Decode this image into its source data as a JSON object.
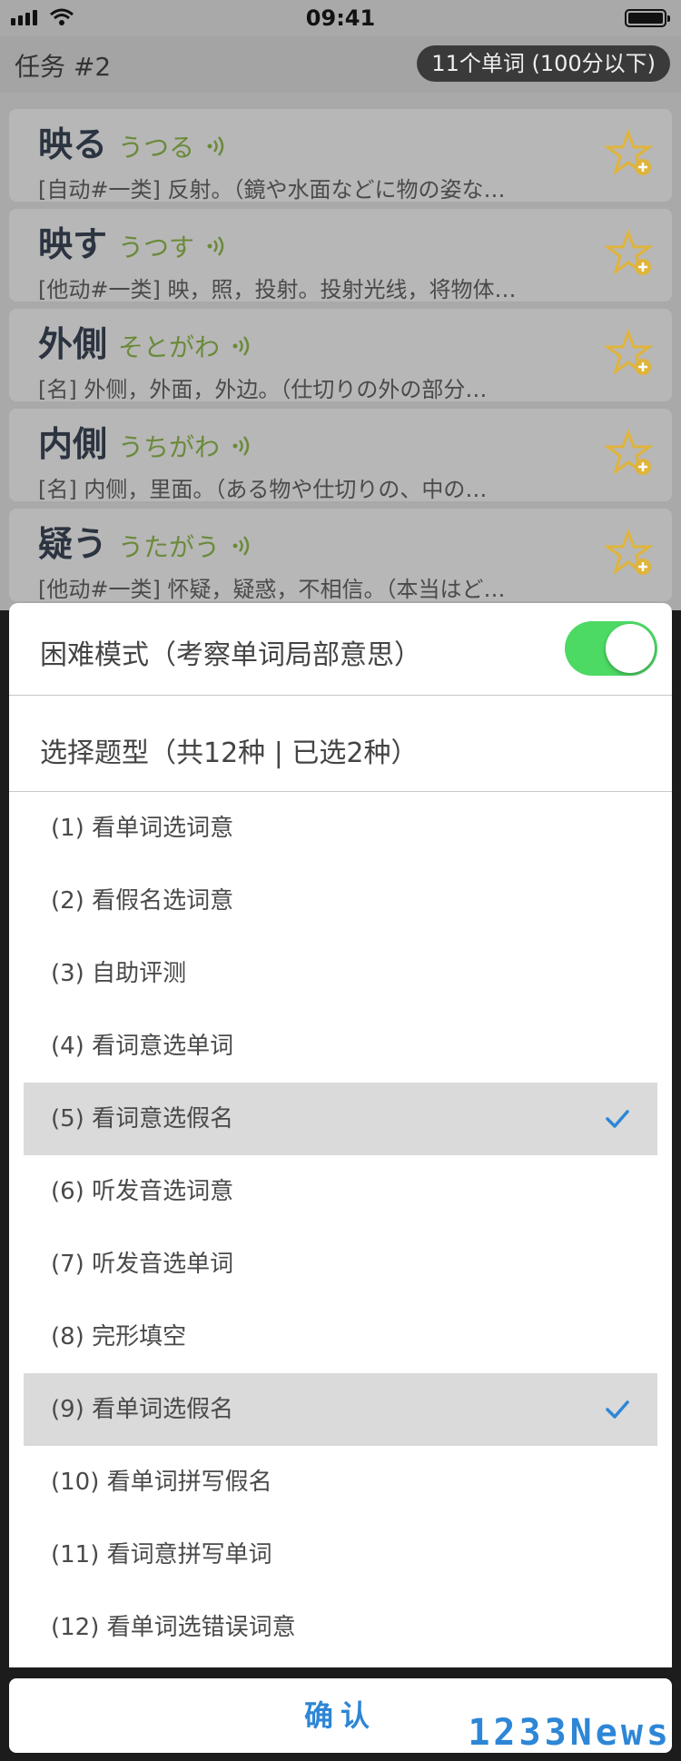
{
  "status_bar": {
    "time": "09:41"
  },
  "nav": {
    "title": "任务 #2",
    "badge": "11个单词 (100分以下)"
  },
  "words": [
    {
      "kanji": "映る",
      "kana": "うつる",
      "definition": "[自动#一类] 反射。（鏡や水面などに物の姿な…"
    },
    {
      "kanji": "映す",
      "kana": "うつす",
      "definition": "[他动#一类] 映，照，投射。投射光线，将物体…"
    },
    {
      "kanji": "外側",
      "kana": "そとがわ",
      "definition": "[名] 外侧，外面，外边。（仕切りの外の部分…"
    },
    {
      "kanji": "内側",
      "kana": "うちがわ",
      "definition": "[名] 内侧，里面。（ある物や仕切りの、中の…"
    },
    {
      "kanji": "疑う",
      "kana": "うたがう",
      "definition": "[他动#一类] 怀疑，疑惑，不相信。（本当はど…"
    }
  ],
  "sheet": {
    "hard_mode_label": "困难模式（考察单词局部意思）",
    "hard_mode_on": true,
    "types_header": "选择题型（共12种 | 已选2种）",
    "types": [
      {
        "label": "(1) 看单词选词意",
        "selected": false
      },
      {
        "label": "(2) 看假名选词意",
        "selected": false
      },
      {
        "label": "(3) 自助评测",
        "selected": false
      },
      {
        "label": "(4) 看词意选单词",
        "selected": false
      },
      {
        "label": "(5) 看词意选假名",
        "selected": true
      },
      {
        "label": "(6) 听发音选词意",
        "selected": false
      },
      {
        "label": "(7) 听发音选单词",
        "selected": false
      },
      {
        "label": "(8) 完形填空",
        "selected": false
      },
      {
        "label": "(9) 看单词选假名",
        "selected": true
      },
      {
        "label": "(10) 看单词拼写假名",
        "selected": false
      },
      {
        "label": "(11) 看词意拼写单词",
        "selected": false
      },
      {
        "label": "(12) 看单词选错误词意",
        "selected": false
      }
    ],
    "confirm_label": "确认"
  },
  "watermark": "1233News",
  "colors": {
    "toggle_on": "#4cd964",
    "accent": "#2d86d6",
    "kana": "#6b8a3a",
    "star": "#e0b43a"
  },
  "icons": {
    "sound": "sound-wave-icon",
    "star": "star-add-icon",
    "check": "checkmark-icon"
  }
}
